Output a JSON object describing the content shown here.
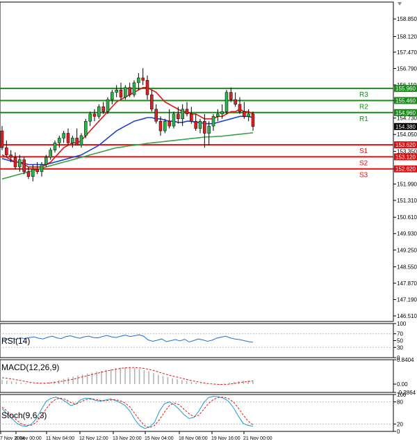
{
  "chart_data": [
    {
      "type": "candlestick",
      "y_ticks": [
        "158.850",
        "158.120",
        "157.470",
        "156.790",
        "156.110",
        "155.460",
        "154.730",
        "154.050",
        "153.350",
        "152.620",
        "151.990",
        "151.310",
        "150.610",
        "149.930",
        "149.250",
        "148.550",
        "147.870",
        "147.190",
        "146.510"
      ],
      "ylim": [
        146.28,
        159.55
      ],
      "x_ticks": [
        "7 Nov 2024",
        "8 Nov 00:00",
        "11 Nov 04:00",
        "12 Nov 12:00",
        "13 Nov 20:00",
        "15 Nov 04:00",
        "18 Nov 08:00",
        "19 Nov 16:00",
        "21 Nov 00:00"
      ],
      "current_price": "154.380",
      "levels": [
        {
          "name": "R3",
          "value": 155.96,
          "price_label": "155.960",
          "color": "#1a8a1a"
        },
        {
          "name": "R2",
          "value": 155.46,
          "price_label": "155.460",
          "color": "#1a8a1a"
        },
        {
          "name": "R1",
          "value": 154.96,
          "price_label": "154.960",
          "color": "#1a8a1a"
        },
        {
          "name": "S1",
          "value": 153.62,
          "price_label": "153.620",
          "color": "#dd1010"
        },
        {
          "name": "S2",
          "value": 153.12,
          "price_label": "153.120",
          "color": "#dd1010"
        },
        {
          "name": "S3",
          "value": 152.62,
          "price_label": "152.620",
          "color": "#dd1010"
        }
      ],
      "candles": [
        [
          154.2,
          154.4,
          153.4,
          153.5
        ],
        [
          153.5,
          153.8,
          153.1,
          153.2
        ],
        [
          153.2,
          153.4,
          152.9,
          153.1
        ],
        [
          153.1,
          153.3,
          152.6,
          152.7
        ],
        [
          152.7,
          153.2,
          152.5,
          153.0
        ],
        [
          153.0,
          153.1,
          152.4,
          152.5
        ],
        [
          152.5,
          152.7,
          152.2,
          152.3
        ],
        [
          152.3,
          152.8,
          152.1,
          152.6
        ],
        [
          152.6,
          152.9,
          152.4,
          152.5
        ],
        [
          152.5,
          152.9,
          152.3,
          152.8
        ],
        [
          152.8,
          153.2,
          152.7,
          153.1
        ],
        [
          153.1,
          153.5,
          153.0,
          153.4
        ],
        [
          153.4,
          153.8,
          153.3,
          153.7
        ],
        [
          153.7,
          154.0,
          153.5,
          153.9
        ],
        [
          153.9,
          154.2,
          153.7,
          154.1
        ],
        [
          154.1,
          154.3,
          153.6,
          153.7
        ],
        [
          153.7,
          154.0,
          153.5,
          153.9
        ],
        [
          153.9,
          154.3,
          153.7,
          153.6
        ],
        [
          153.6,
          154.1,
          153.5,
          154.0
        ],
        [
          154.0,
          154.7,
          153.9,
          154.6
        ],
        [
          154.6,
          155.0,
          154.4,
          154.9
        ],
        [
          154.9,
          155.1,
          154.6,
          154.8
        ],
        [
          154.8,
          155.3,
          154.7,
          155.2
        ],
        [
          155.2,
          155.4,
          154.9,
          155.0
        ],
        [
          155.0,
          155.6,
          154.9,
          155.5
        ],
        [
          155.5,
          155.9,
          155.3,
          155.8
        ],
        [
          155.8,
          156.1,
          155.6,
          155.9
        ],
        [
          155.9,
          156.2,
          155.5,
          155.6
        ],
        [
          155.6,
          156.1,
          155.5,
          156.0
        ],
        [
          156.0,
          156.2,
          155.6,
          155.7
        ],
        [
          155.7,
          156.3,
          155.6,
          156.2
        ],
        [
          156.2,
          156.6,
          155.9,
          156.4
        ],
        [
          156.4,
          156.8,
          156.1,
          156.3
        ],
        [
          156.3,
          156.5,
          155.5,
          155.7
        ],
        [
          155.7,
          155.9,
          155.0,
          155.1
        ],
        [
          155.1,
          155.3,
          154.5,
          154.6
        ],
        [
          154.6,
          154.8,
          154.0,
          154.2
        ],
        [
          154.2,
          154.7,
          154.1,
          154.6
        ],
        [
          154.6,
          155.1,
          154.3,
          154.4
        ],
        [
          154.4,
          155.0,
          154.3,
          154.9
        ],
        [
          154.9,
          155.2,
          154.5,
          154.7
        ],
        [
          154.7,
          155.3,
          154.4,
          155.1
        ],
        [
          155.1,
          155.4,
          154.8,
          154.9
        ],
        [
          154.9,
          155.2,
          154.5,
          154.6
        ],
        [
          154.6,
          154.9,
          154.2,
          154.3
        ],
        [
          154.3,
          154.7,
          154.1,
          154.6
        ],
        [
          154.6,
          154.9,
          153.5,
          154.1
        ],
        [
          154.1,
          154.6,
          153.6,
          154.4
        ],
        [
          154.4,
          154.9,
          154.2,
          154.8
        ],
        [
          154.8,
          155.1,
          154.6,
          154.9
        ],
        [
          154.9,
          155.3,
          154.7,
          155.0
        ],
        [
          155.0,
          155.9,
          154.9,
          155.8
        ],
        [
          155.8,
          156.0,
          155.4,
          155.5
        ],
        [
          155.5,
          155.8,
          155.2,
          155.3
        ],
        [
          155.3,
          155.6,
          154.9,
          155.0
        ],
        [
          155.0,
          155.4,
          154.7,
          154.8
        ],
        [
          154.8,
          155.1,
          154.6,
          154.9
        ],
        [
          154.9,
          155.0,
          154.2,
          154.38
        ]
      ],
      "ma_fast": [
        153.2,
        153.1,
        153.0,
        152.9,
        152.9,
        152.8,
        152.7,
        152.7,
        152.7,
        152.7,
        152.8,
        152.9,
        153.1,
        153.3,
        153.5,
        153.6,
        153.7,
        153.7,
        153.8,
        154.0,
        154.2,
        154.4,
        154.6,
        154.8,
        155.0,
        155.2,
        155.4,
        155.5,
        155.6,
        155.7,
        155.8,
        155.9,
        156.0,
        156.0,
        155.9,
        155.8,
        155.6,
        155.4,
        155.3,
        155.2,
        155.1,
        155.0,
        155.0,
        154.9,
        154.9,
        154.8,
        154.7,
        154.7,
        154.7,
        154.8,
        154.8,
        154.9,
        155.0,
        155.0,
        155.1,
        155.0,
        155.0,
        154.9
      ],
      "ma_mid": [
        153.05,
        153.0,
        152.95,
        152.9,
        152.9,
        152.85,
        152.8,
        152.8,
        152.8,
        152.8,
        152.8,
        152.85,
        152.9,
        152.95,
        153.0,
        153.05,
        153.1,
        153.15,
        153.2,
        153.3,
        153.4,
        153.5,
        153.6,
        153.75,
        153.9,
        154.05,
        154.2,
        154.3,
        154.4,
        154.5,
        154.6,
        154.65,
        154.7,
        154.75,
        154.75,
        154.7,
        154.7,
        154.65,
        154.6,
        154.6,
        154.55,
        154.55,
        154.6,
        154.6,
        154.55,
        154.55,
        154.5,
        154.5,
        154.5,
        154.55,
        154.6,
        154.65,
        154.7,
        154.75,
        154.8,
        154.8,
        154.8,
        154.75
      ],
      "ma_slow": [
        152.2,
        152.25,
        152.3,
        152.35,
        152.4,
        152.45,
        152.5,
        152.55,
        152.6,
        152.65,
        152.7,
        152.75,
        152.8,
        152.85,
        152.9,
        152.95,
        153.0,
        153.05,
        153.1,
        153.15,
        153.2,
        153.25,
        153.3,
        153.35,
        153.4,
        153.45,
        153.5,
        153.52,
        153.55,
        153.58,
        153.6,
        153.62,
        153.65,
        153.68,
        153.7,
        153.72,
        153.74,
        153.76,
        153.78,
        153.8,
        153.82,
        153.84,
        153.86,
        153.88,
        153.9,
        153.92,
        153.94,
        153.95,
        153.96,
        153.97,
        153.98,
        154.0,
        154.02,
        154.04,
        154.06,
        154.08,
        154.1,
        154.12
      ],
      "ma_colors": {
        "fast": "#e01818",
        "mid": "#2040d0",
        "slow": "#36a24a"
      }
    },
    {
      "type": "line",
      "title": "RSI(14)",
      "y_ticks": [
        "100",
        "70",
        "50",
        "30",
        "0"
      ],
      "ylim": [
        0,
        100
      ],
      "values": [
        52,
        55,
        57,
        54,
        58,
        56,
        59,
        61,
        57,
        55,
        60,
        63,
        58,
        56,
        62,
        64,
        60,
        57,
        61,
        63,
        59,
        58,
        62,
        65,
        61,
        59,
        63,
        66,
        62,
        64,
        67,
        63,
        52,
        48,
        51,
        55,
        47,
        50,
        53,
        49,
        54,
        46,
        50,
        55,
        52,
        48,
        51,
        57,
        60,
        63,
        58,
        55,
        53,
        50,
        47,
        45
      ],
      "color": "#2070d0"
    },
    {
      "type": "bar",
      "title": "MACD(12,26,9)",
      "y_ticks": [
        "0.8404",
        "0.00",
        "-0.2864"
      ],
      "ylim": [
        -0.2864,
        0.8404
      ],
      "histogram": [
        0.15,
        0.12,
        0.1,
        0.08,
        0.05,
        0.03,
        0.02,
        0.01,
        0.02,
        0.04,
        0.07,
        0.1,
        0.14,
        0.18,
        0.22,
        0.26,
        0.3,
        0.33,
        0.36,
        0.4,
        0.43,
        0.46,
        0.49,
        0.52,
        0.55,
        0.57,
        0.58,
        0.57,
        0.55,
        0.52,
        0.48,
        0.44,
        0.38,
        0.32,
        0.28,
        0.24,
        0.2,
        0.17,
        0.14,
        0.11,
        0.08,
        0.05,
        0.03,
        0.01,
        0.0,
        -0.01,
        -0.02,
        0.02,
        0.05,
        0.08,
        0.1,
        0.12,
        0.13,
        0.11
      ],
      "signal": [
        0.22,
        0.2,
        0.18,
        0.15,
        0.12,
        0.09,
        0.06,
        0.04,
        0.03,
        0.03,
        0.04,
        0.06,
        0.08,
        0.11,
        0.14,
        0.17,
        0.21,
        0.25,
        0.29,
        0.33,
        0.37,
        0.41,
        0.45,
        0.48,
        0.51,
        0.54,
        0.56,
        0.57,
        0.57,
        0.56,
        0.54,
        0.51,
        0.47,
        0.42,
        0.37,
        0.32,
        0.28,
        0.24,
        0.2,
        0.16,
        0.12,
        0.09,
        0.06,
        0.03,
        0.01,
        0.0,
        -0.01,
        -0.01,
        0.0,
        0.02,
        0.05,
        0.07,
        0.09,
        0.11
      ],
      "colors": {
        "histogram": "#b0b0b0",
        "signal": "#e01818"
      }
    },
    {
      "type": "line",
      "title": "Stoch(9,6,3)",
      "y_ticks": [
        "100",
        "80",
        "20",
        "0"
      ],
      "ylim": [
        0,
        100
      ],
      "series": [
        {
          "values": [
            62,
            48,
            35,
            22,
            15,
            14,
            20,
            35,
            60,
            82,
            90,
            93,
            88,
            80,
            70,
            74,
            86,
            90,
            89,
            84,
            82,
            85,
            88,
            84,
            78,
            70,
            55,
            32,
            15,
            8,
            12,
            25,
            55,
            75,
            80,
            72,
            60,
            45,
            35,
            38,
            55,
            78,
            92,
            95,
            94,
            90,
            82,
            65,
            42,
            22,
            16,
            14
          ],
          "color": "#1a9ad0"
        },
        {
          "values": [
            66,
            55,
            43,
            30,
            20,
            16,
            17,
            25,
            42,
            62,
            78,
            88,
            90,
            86,
            78,
            74,
            80,
            86,
            88,
            87,
            84,
            83,
            85,
            86,
            83,
            77,
            66,
            48,
            30,
            15,
            10,
            16,
            32,
            52,
            70,
            77,
            72,
            60,
            48,
            40,
            44,
            60,
            76,
            87,
            92,
            93,
            89,
            80,
            64,
            45,
            28,
            18
          ],
          "color": "#e01818"
        }
      ]
    }
  ]
}
